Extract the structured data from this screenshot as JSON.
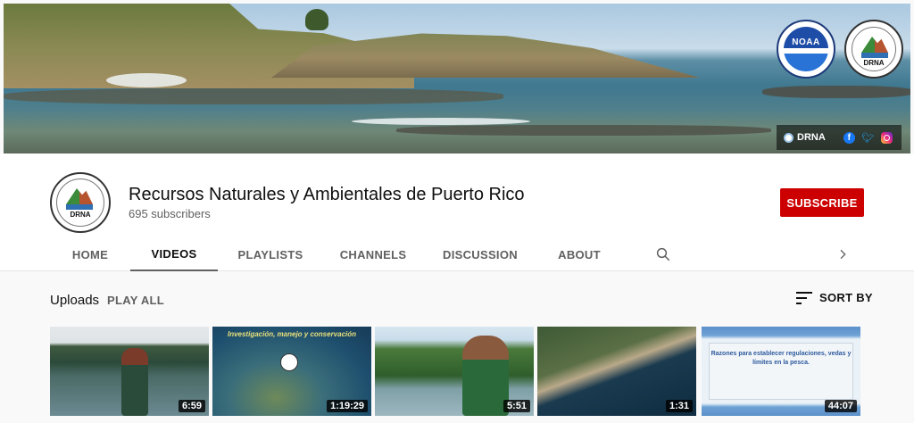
{
  "banner": {
    "links": {
      "site_label": "DRNA"
    },
    "seals": {
      "noaa": "NOAA",
      "drna": "DRNA"
    }
  },
  "channel": {
    "name": "Recursos Naturales y Ambientales de Puerto Rico",
    "subscribers": "695 subscribers",
    "avatar_text": "DRNA",
    "subscribe_label": "SUBSCRIBE"
  },
  "tabs": [
    {
      "label": "HOME",
      "active": false
    },
    {
      "label": "VIDEOS",
      "active": true
    },
    {
      "label": "PLAYLISTS",
      "active": false
    },
    {
      "label": "CHANNELS",
      "active": false
    },
    {
      "label": "DISCUSSION",
      "active": false
    },
    {
      "label": "ABOUT",
      "active": false
    }
  ],
  "section": {
    "title": "Uploads",
    "play_all": "PLAY ALL",
    "sort_by": "SORT BY"
  },
  "videos": [
    {
      "duration": "6:59"
    },
    {
      "duration": "1:19:29",
      "overlay_title": "Investigación, manejo y conservación"
    },
    {
      "duration": "5:51"
    },
    {
      "duration": "1:31"
    },
    {
      "duration": "44:07",
      "overlay_title": "Razones para establecer regulaciones, vedas y límites en la pesca."
    }
  ],
  "icons": {
    "search": "search-icon",
    "chevron": "chevron-right-icon",
    "sort": "sort-icon",
    "facebook": "facebook-icon",
    "twitter": "twitter-icon",
    "instagram": "instagram-icon"
  },
  "colors": {
    "subscribe": "#cc0000",
    "text_primary": "#0f0f0f",
    "text_secondary": "#606060"
  }
}
